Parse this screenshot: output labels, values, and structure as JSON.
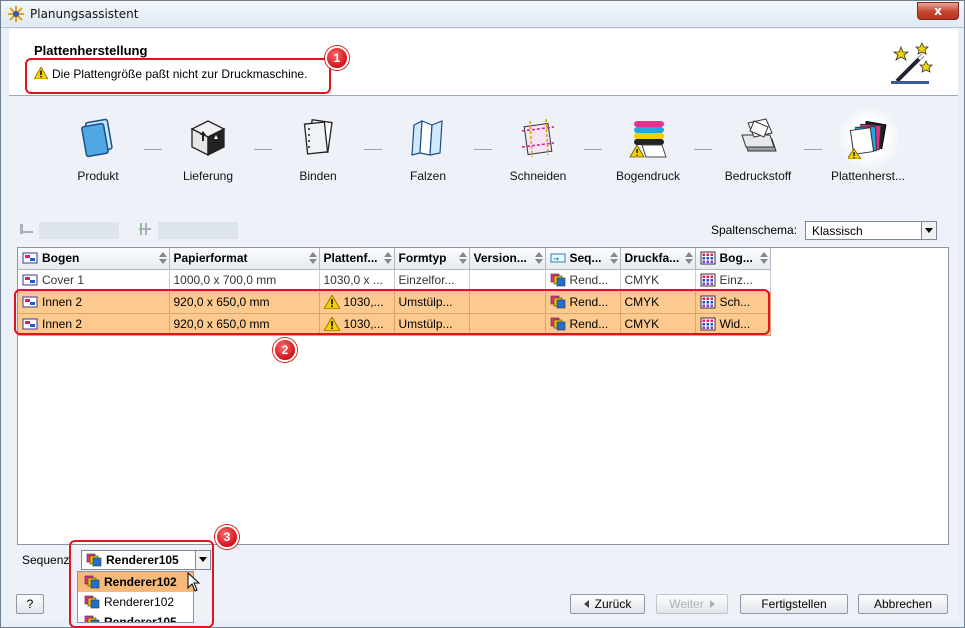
{
  "window": {
    "title": "Planungsassistent",
    "close_label": "x"
  },
  "header": {
    "title": "Plattenherstellung",
    "message": "Die Plattengröße paßt nicht zur Druckmaschine."
  },
  "steps": [
    {
      "label": "Produkt",
      "icon": "product-icon",
      "warning": false,
      "active": false
    },
    {
      "label": "Lieferung",
      "icon": "delivery-box-icon",
      "warning": false,
      "active": false
    },
    {
      "label": "Binden",
      "icon": "binding-icon",
      "warning": false,
      "active": false
    },
    {
      "label": "Falzen",
      "icon": "folding-icon",
      "warning": false,
      "active": false
    },
    {
      "label": "Schneiden",
      "icon": "cutting-icon",
      "warning": false,
      "active": false
    },
    {
      "label": "Bogendruck",
      "icon": "sheet-print-icon",
      "warning": true,
      "active": false
    },
    {
      "label": "Bedruckstoff",
      "icon": "paper-stock-icon",
      "warning": false,
      "active": false
    },
    {
      "label": "Plattenherst...",
      "icon": "plates-icon",
      "warning": true,
      "active": true
    }
  ],
  "toolbar": {
    "schema_label": "Spaltenschema:",
    "schema_value": "Klassisch"
  },
  "table": {
    "columns": [
      "Bogen",
      "Papierformat",
      "Plattenf...",
      "Formtyp",
      "Version...",
      "Seq...",
      "Druckfa...",
      "Bog..."
    ],
    "rows": [
      {
        "bogen": "Cover 1",
        "papier": "1000,0 x 700,0 mm",
        "platte": "1030,0 x ...",
        "formtyp": "Einzelfor...",
        "version": "",
        "seq": "Rend...",
        "druck": "CMYK",
        "bog": "Einz...",
        "selected": false,
        "warn": false
      },
      {
        "bogen": "Innen 2",
        "papier": "920,0 x 650,0 mm",
        "platte": "1030,...",
        "formtyp": "Umstülp...",
        "version": "",
        "seq": "Rend...",
        "druck": "CMYK",
        "bog": "Sch...",
        "selected": true,
        "warn": true
      },
      {
        "bogen": "Innen 2",
        "papier": "920,0 x 650,0 mm",
        "platte": "1030,...",
        "formtyp": "Umstülp...",
        "version": "",
        "seq": "Rend...",
        "druck": "CMYK",
        "bog": "Wid...",
        "selected": true,
        "warn": true
      }
    ]
  },
  "sequence": {
    "label": "Sequenz",
    "value": "Renderer105",
    "options": [
      {
        "label": "Renderer102",
        "highlighted": true,
        "bold": true
      },
      {
        "label": "Renderer102",
        "highlighted": false,
        "bold": false
      },
      {
        "label": "Renderer105",
        "highlighted": false,
        "bold": true
      }
    ]
  },
  "buttons": {
    "help": "?",
    "back": "Zurück",
    "next": "Weiter",
    "finish": "Fertigstellen",
    "cancel": "Abbrechen"
  },
  "annotations": [
    "1",
    "2",
    "3"
  ],
  "colors": {
    "selected_row": "#fcc98e",
    "annotation_red": "#e0141e",
    "highlight_item": "#f7b97a"
  }
}
